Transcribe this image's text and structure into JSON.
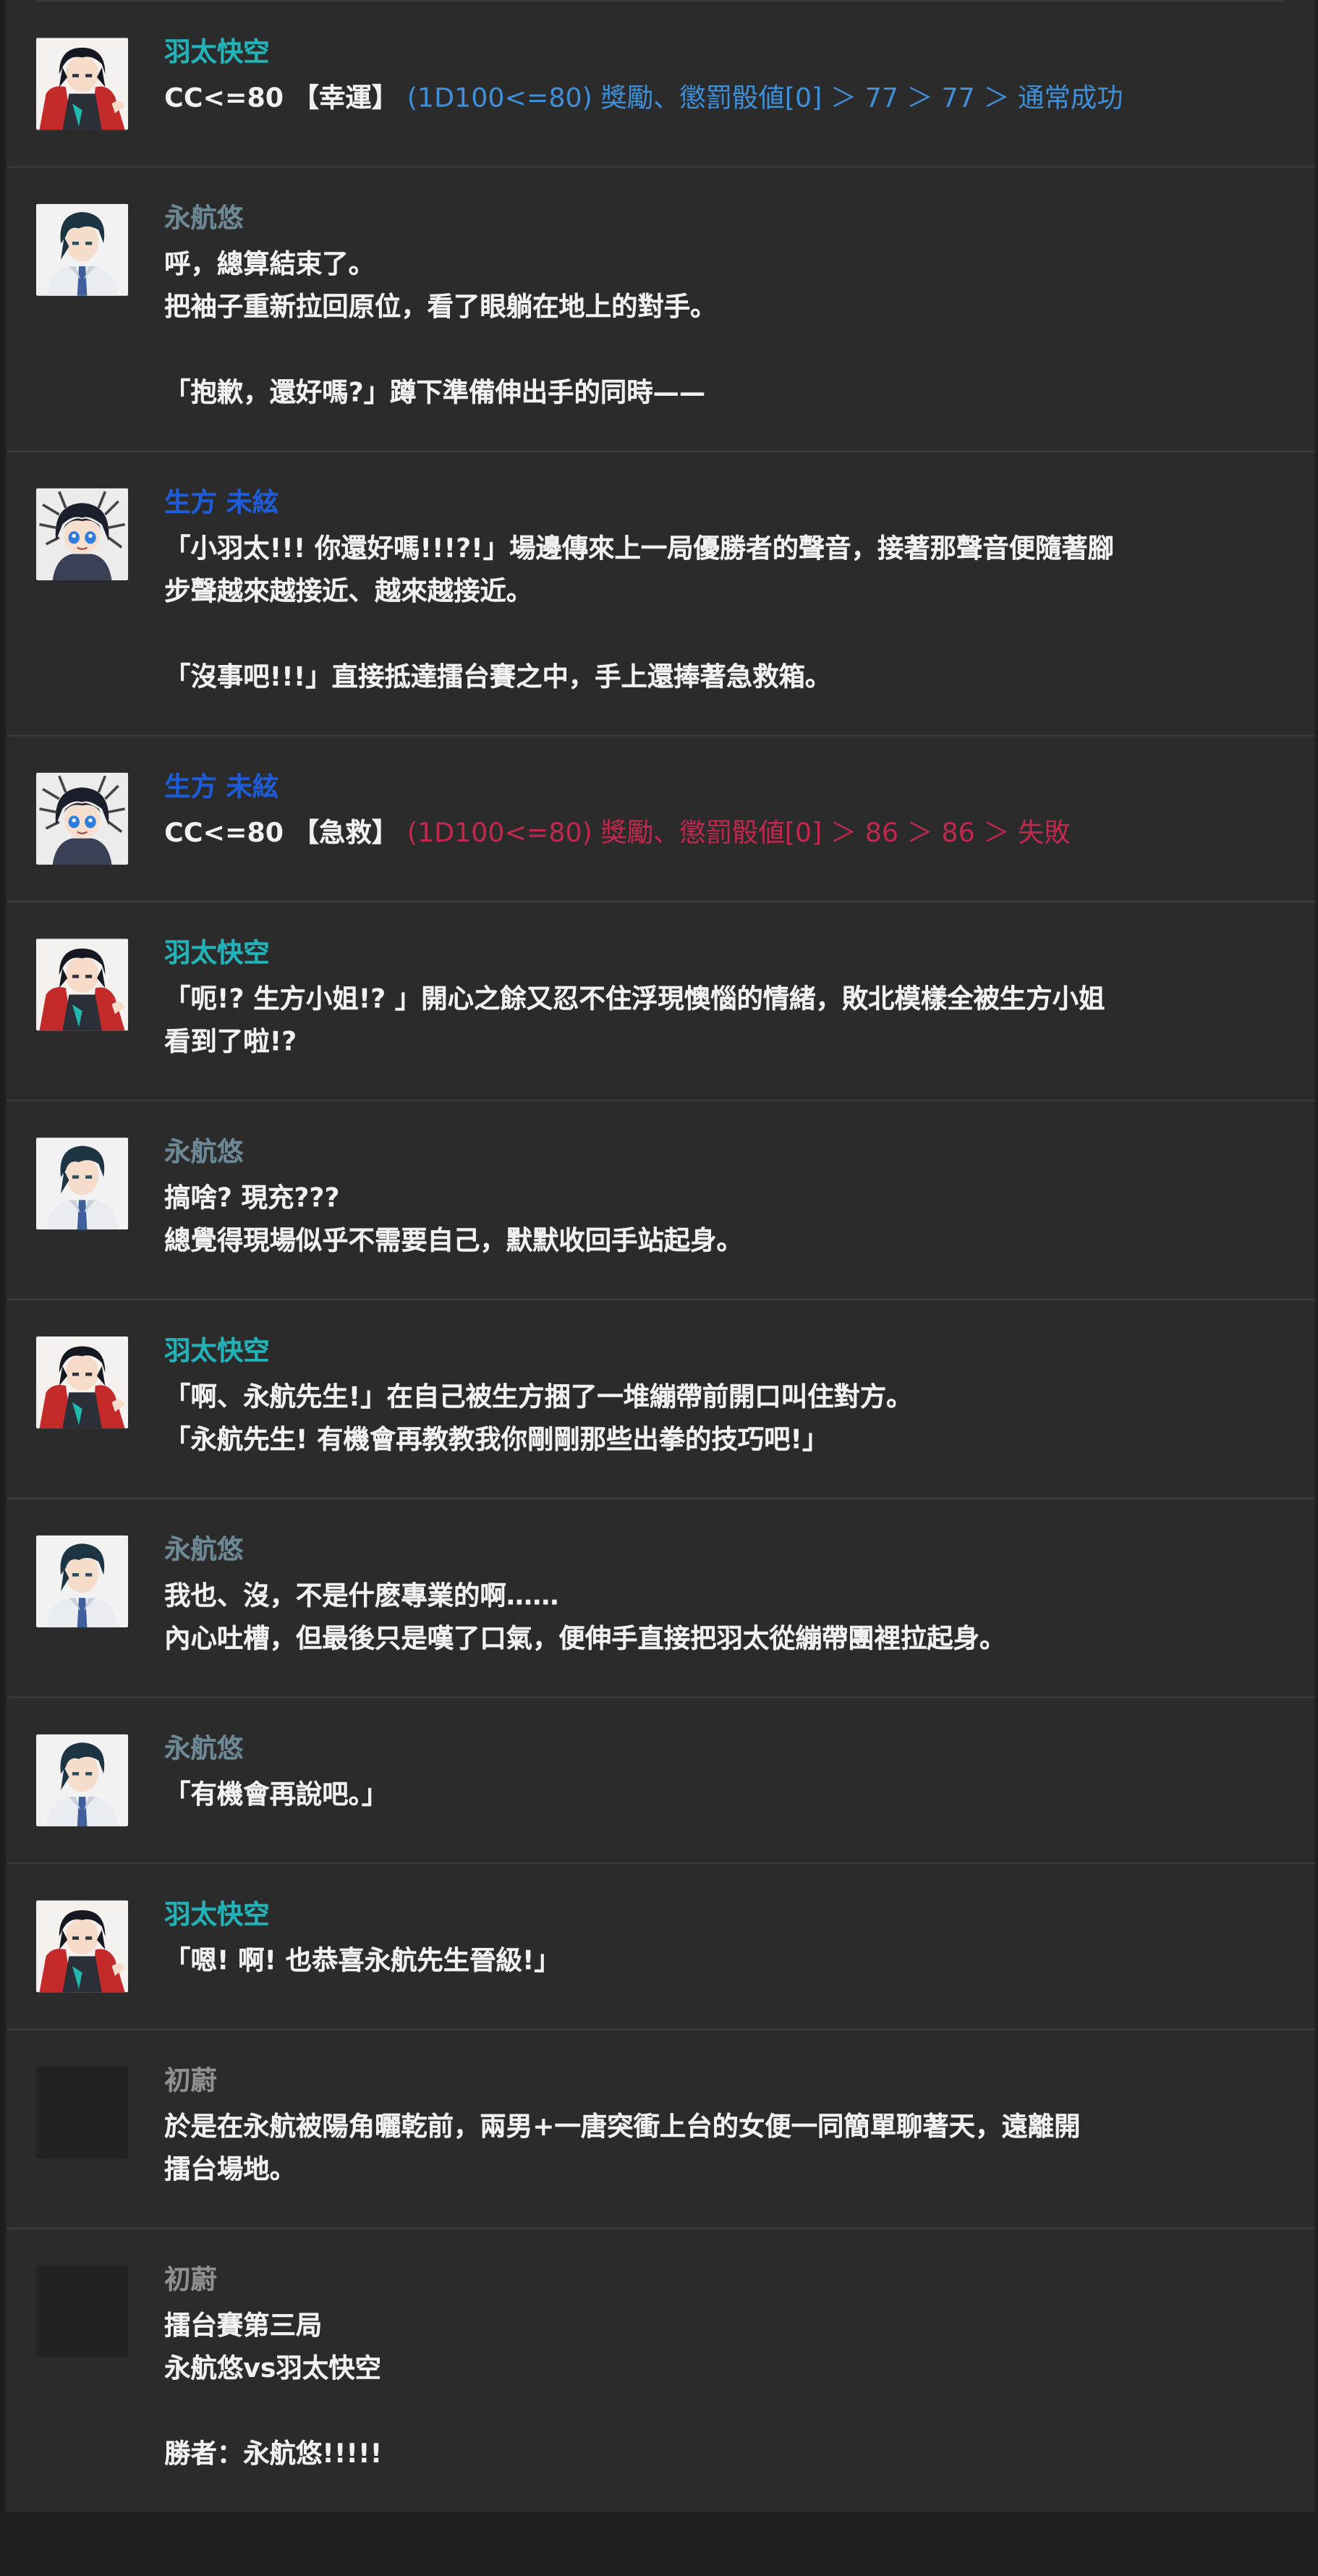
{
  "colors": {
    "background": "#2b2b2b",
    "divider": "#3c3c3c",
    "text": "#f1f1f1",
    "speaker_teal": "#21b3b7",
    "speaker_gray_blue": "#6c8894",
    "speaker_blue": "#1e5bd6",
    "speaker_gray": "#8f8f8f",
    "roll_success": "#3f8fd9",
    "roll_failure": "#c0284d"
  },
  "messages": [
    {
      "speaker": "羽太快空",
      "speaker_color": "#21b3b7",
      "avatar": "hatakuu-avatar",
      "roll": {
        "command": "CC<=80 【幸運】",
        "result": "(1D100<=80) 獎勵、懲罰骰値[0] ＞ 77 ＞ 77 ＞ 通常成功",
        "result_color": "#3f8fd9"
      },
      "lines": []
    },
    {
      "speaker": "永航悠",
      "speaker_color": "#6c8894",
      "avatar": "eikouyuu-avatar",
      "lines": [
        "呼，總算結束了。",
        "把袖子重新拉回原位，看了眼躺在地上的對手。",
        "",
        "「抱歉，還好嗎?」蹲下準備伸出手的同時——"
      ]
    },
    {
      "speaker": "生方 未絃",
      "speaker_color": "#1e5bd6",
      "avatar": "ubukata-avatar",
      "lines": [
        "「小羽太!!! 你還好嗎!!!?!」場邊傳來上一局優勝者的聲音，接著那聲音便隨著腳",
        "步聲越來越接近、越來越接近。",
        "",
        "「沒事吧!!!」直接抵達擂台賽之中，手上還捧著急救箱。"
      ]
    },
    {
      "speaker": "生方 未絃",
      "speaker_color": "#1e5bd6",
      "avatar": "ubukata-avatar",
      "roll": {
        "command": "CC<=80 【急救】",
        "result": "(1D100<=80) 獎勵、懲罰骰値[0] ＞ 86 ＞ 86 ＞ 失敗",
        "result_color": "#c0284d"
      },
      "lines": []
    },
    {
      "speaker": "羽太快空",
      "speaker_color": "#21b3b7",
      "avatar": "hatakuu-avatar",
      "lines": [
        "「呃!? 生方小姐!? 」開心之餘又忍不住浮現懊惱的情緒，敗北模樣全被生方小姐",
        "看到了啦!?"
      ]
    },
    {
      "speaker": "永航悠",
      "speaker_color": "#6c8894",
      "avatar": "eikouyuu-avatar",
      "lines": [
        "搞啥? 現充???",
        "總覺得現場似乎不需要自己，默默收回手站起身。"
      ]
    },
    {
      "speaker": "羽太快空",
      "speaker_color": "#21b3b7",
      "avatar": "hatakuu-avatar",
      "lines": [
        "「啊、永航先生!」在自己被生方捆了一堆繃帶前開口叫住對方。",
        "「永航先生! 有機會再教教我你剛剛那些出拳的技巧吧!」"
      ]
    },
    {
      "speaker": "永航悠",
      "speaker_color": "#6c8894",
      "avatar": "eikouyuu-avatar",
      "lines": [
        "我也、沒，不是什麽專業的啊……",
        "內心吐槽，但最後只是嘆了口氣，便伸手直接把羽太從繃帶團裡拉起身。"
      ]
    },
    {
      "speaker": "永航悠",
      "speaker_color": "#6c8894",
      "avatar": "eikouyuu-avatar",
      "lines": [
        "「有機會再說吧。」"
      ]
    },
    {
      "speaker": "羽太快空",
      "speaker_color": "#21b3b7",
      "avatar": "hatakuu-avatar",
      "lines": [
        "「嗯! 啊! 也恭喜永航先生晉級!」"
      ]
    },
    {
      "speaker": "初蔚",
      "speaker_color": "#8f8f8f",
      "avatar": "blank",
      "lines": [
        "於是在永航被陽角曬乾前，兩男+一唐突衝上台的女便一同簡單聊著天，遠離開",
        "擂台場地。"
      ]
    },
    {
      "speaker": "初蔚",
      "speaker_color": "#8f8f8f",
      "avatar": "blank",
      "lines": [
        "擂台賽第三局",
        "永航悠vs羽太快空",
        "",
        "勝者：永航悠!!!!!"
      ]
    }
  ]
}
